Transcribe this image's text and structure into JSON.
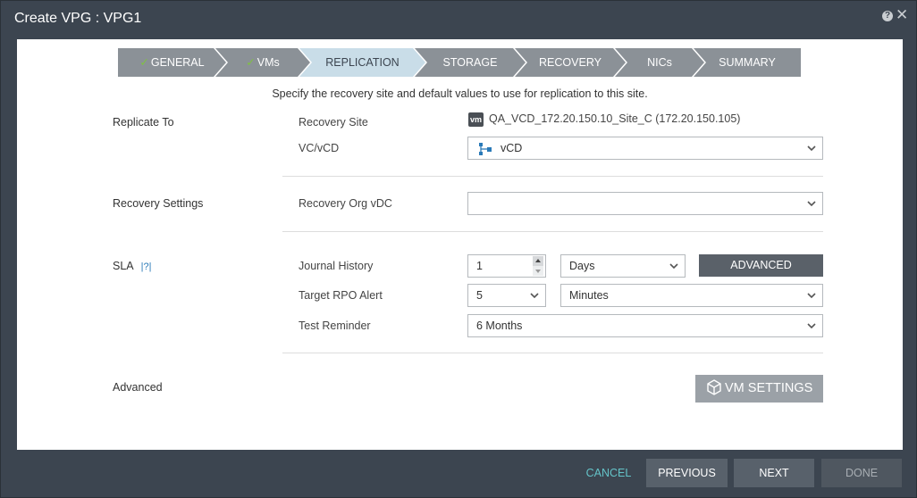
{
  "window": {
    "title": "Create VPG : VPG1",
    "help_label": "?",
    "close_label": "✕"
  },
  "steps": [
    {
      "label": "GENERAL",
      "done": true
    },
    {
      "label": "VMs",
      "done": true
    },
    {
      "label": "REPLICATION",
      "done": false,
      "active": true
    },
    {
      "label": "STORAGE",
      "done": false
    },
    {
      "label": "RECOVERY",
      "done": false
    },
    {
      "label": "NICs",
      "done": false
    },
    {
      "label": "SUMMARY",
      "done": false
    }
  ],
  "check_mark": "✓",
  "instruction": "Specify the recovery site and default values to use for replication to this site.",
  "replicate_to": {
    "section_label": "Replicate To",
    "recovery_site_label": "Recovery Site",
    "recovery_site_icon_text": "vm",
    "recovery_site_value": "QA_VCD_172.20.150.10_Site_C (172.20.150.105)",
    "vc_label": "VC/vCD",
    "vc_value": "vCD"
  },
  "recovery_settings": {
    "section_label": "Recovery Settings",
    "org_vdc_label": "Recovery Org vDC",
    "org_vdc_value": ""
  },
  "sla": {
    "section_label": "SLA",
    "help_link": "|?|",
    "journal_history_label": "Journal History",
    "journal_history_value": "1",
    "journal_history_unit": "Days",
    "advanced_button": "ADVANCED",
    "target_rpo_label": "Target RPO Alert",
    "target_rpo_value": "5",
    "target_rpo_unit": "Minutes",
    "test_reminder_label": "Test Reminder",
    "test_reminder_value": "6 Months"
  },
  "advanced": {
    "section_label": "Advanced",
    "vm_settings_button": "VM SETTINGS"
  },
  "footer": {
    "cancel": "CANCEL",
    "previous": "PREVIOUS",
    "next": "NEXT",
    "done": "DONE"
  },
  "colors": {
    "step_done": "#8b9197",
    "step_active": "#c9dde8",
    "step_pending": "#8b9197",
    "check": "#7fc241",
    "link": "#2a7ab8",
    "cancel": "#64c3c8"
  }
}
